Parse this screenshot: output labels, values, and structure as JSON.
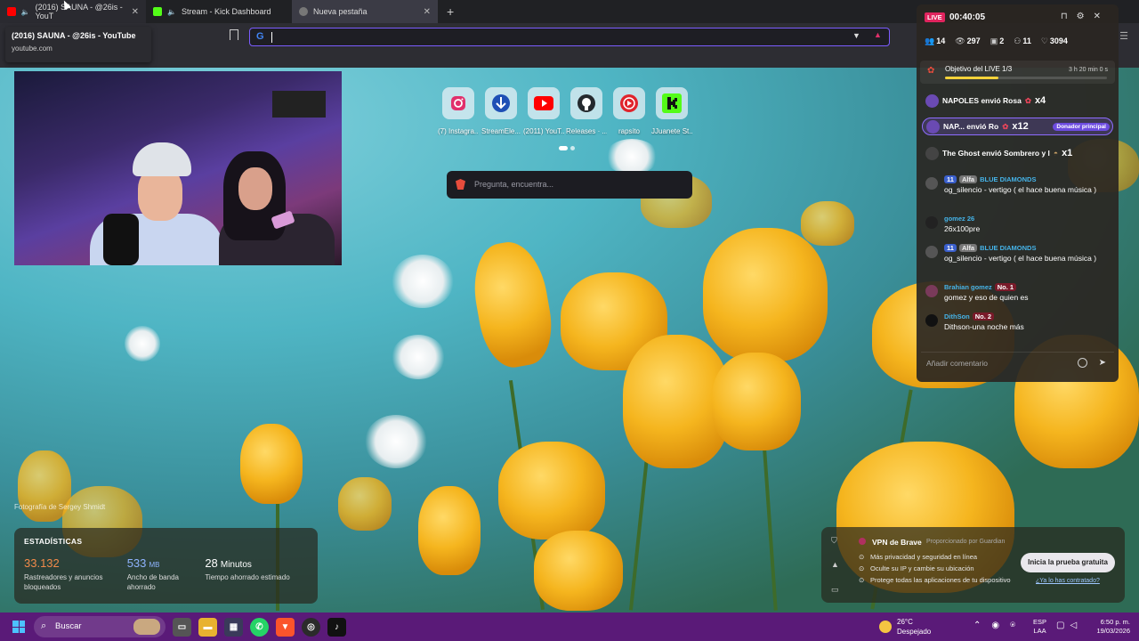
{
  "tabs": [
    {
      "title": "(2016) SAUNA - @26is - YouT",
      "fav_color": "#ff0000",
      "audio": true
    },
    {
      "title": "Stream - Kick Dashboard",
      "fav_color": "#53fc18",
      "audio": true
    },
    {
      "title": "Nueva pestaña",
      "fav_color": "#cccccc",
      "audio": false
    }
  ],
  "tooltip": {
    "title": "(2016) SAUNA - @26is - YouTube",
    "url": "youtube.com"
  },
  "urlbar": {
    "value": ""
  },
  "shortcuts": [
    {
      "label": "(7) Instagra...",
      "color": "#e1306c",
      "icon": "instagram-icon"
    },
    {
      "label": "StreamEle...",
      "color": "#2d6be0",
      "icon": "streamelements-icon"
    },
    {
      "label": "(2011) YouT...",
      "color": "#ff0000",
      "icon": "youtube-icon"
    },
    {
      "label": "Releases · ...",
      "color": "#24292e",
      "icon": "github-icon"
    },
    {
      "label": "rapsito",
      "color": "#e0242c",
      "icon": "play-icon"
    },
    {
      "label": "JJuanete St...",
      "color": "#53fc18",
      "icon": "kick-icon"
    }
  ],
  "search": {
    "placeholder": "Pregunta, encuentra..."
  },
  "photo_credit": "Fotografía de Sergey Shmidt",
  "stats": {
    "header": "ESTADÍSTICAS",
    "items": [
      {
        "value": "33.132",
        "unit": "",
        "label": "Rastreadores y anuncios bloqueados",
        "color": "#f28a4a"
      },
      {
        "value": "533",
        "unit": "MB",
        "label": "Ancho de banda ahorrado",
        "color": "#8fb4ff"
      },
      {
        "value": "28",
        "unit": "Minutos",
        "label": "Tiempo ahorrado estimado",
        "color": "#ffffff"
      }
    ]
  },
  "vpn": {
    "title": "VPN de Brave",
    "provider": "Proporcionado por Guardian",
    "items": [
      "Más privacidad y seguridad en línea",
      "Oculte su IP y cambie su ubicación",
      "Protege todas las aplicaciones de tu dispositivo"
    ],
    "button": "Inicia la prueba gratuita",
    "link": "¿Ya lo has contratado?"
  },
  "live": {
    "badge": "LIVE",
    "timer": "00:40:05",
    "stats": {
      "followers": "14",
      "viewers": "297",
      "gifts": "2",
      "members": "11",
      "likes": "3094"
    },
    "goal": {
      "label": "Objetivo del LIVE 1/3",
      "remaining": "3 h 20 min 0 s",
      "progress": 0.33
    },
    "gifts": [
      {
        "text": "NAPOLES envió Rosa",
        "count": "x4",
        "highlight": false,
        "donor": ""
      },
      {
        "text": "NAP... envió Ro",
        "count": "x12",
        "highlight": true,
        "donor": "Donador principal"
      },
      {
        "text": "The Ghost envió Sombrero y l",
        "count": "x1",
        "highlight": false,
        "donor": ""
      }
    ],
    "messages": [
      {
        "level": "11",
        "tag": "Alfa",
        "name": "BLUE DIAMONDS",
        "rank": "",
        "text": "og_silencio - vertigo ( el hace buena música )"
      },
      {
        "level": "",
        "tag": "",
        "name": "gomez 26",
        "rank": "",
        "text": "26x100pre"
      },
      {
        "level": "11",
        "tag": "Alfa",
        "name": "BLUE DIAMONDS",
        "rank": "",
        "text": "og_silencio - vertigo ( el hace buena música )"
      },
      {
        "level": "",
        "tag": "",
        "name": "Brahian gomez",
        "rank": "No. 1",
        "text": "gomez y eso de quien es"
      },
      {
        "level": "",
        "tag": "",
        "name": "DithSon",
        "rank": "No. 2",
        "text": "Dithson-una noche más"
      }
    ],
    "comment_placeholder": "Añadir comentario"
  },
  "taskbar": {
    "search": "Buscar",
    "weather_temp": "26°C",
    "weather_desc": "Despejado",
    "lang1": "ESP",
    "lang2": "LAA",
    "time": "6:50 p. m.",
    "date": "19/03/2026"
  }
}
